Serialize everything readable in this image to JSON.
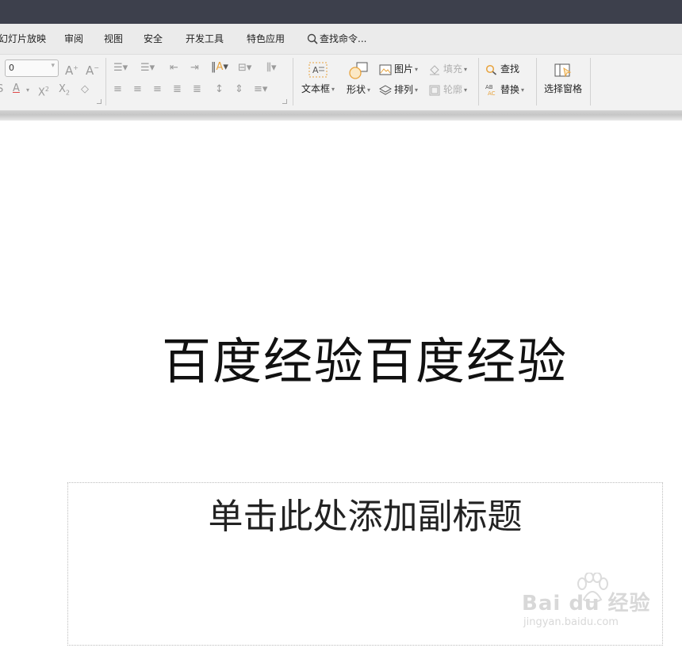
{
  "menu": {
    "items": [
      "幻灯片放映",
      "审阅",
      "视图",
      "安全",
      "开发工具",
      "特色应用"
    ],
    "search_label": "查找命令..."
  },
  "ribbon": {
    "font_size_value": "0",
    "textbox_label": "文本框",
    "shape_label": "形状",
    "picture_label": "图片",
    "fill_label": "填充",
    "arrange_label": "排列",
    "outline_label": "轮廓",
    "find_label": "查找",
    "replace_label": "替换",
    "selection_pane_label": "选择窗格"
  },
  "slide": {
    "title": "百度经验百度经验",
    "subtitle_placeholder": "单击此处添加副标题"
  },
  "watermark": {
    "brand": "Bai du 经验",
    "url": "jingyan.baidu.com"
  },
  "colors": {
    "titlebar": "#3d404c",
    "menubar": "#ebebeb",
    "ribbon": "#f2f2f2",
    "accent_orange": "#e8a33d"
  }
}
